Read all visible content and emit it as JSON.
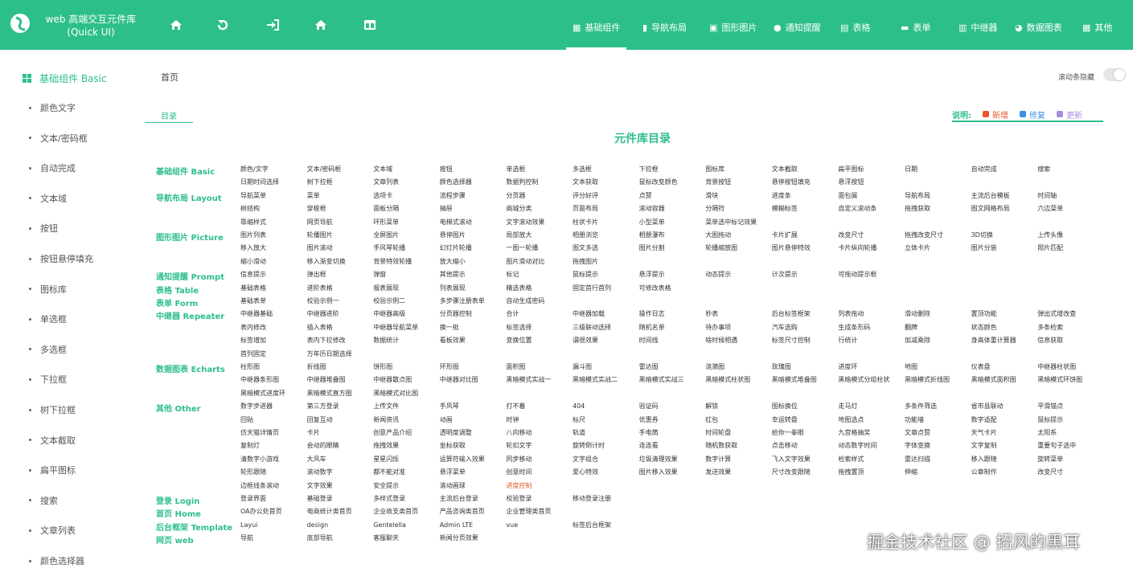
{
  "header": {
    "brand_line1": "web 高端交互元件库",
    "brand_line2": "(Quick UI)",
    "nav_icons": [
      "home-icon",
      "undo-icon",
      "login-icon",
      "home-icon",
      "layout-icon"
    ],
    "menu": [
      {
        "label": "基础组件",
        "icon": "grid-icon",
        "active": true
      },
      {
        "label": "导航布局",
        "icon": "book-icon"
      },
      {
        "label": "图形图片",
        "icon": "image-icon"
      },
      {
        "label": "通知提醒",
        "icon": "bell-icon"
      },
      {
        "label": "表格",
        "icon": "table-icon"
      },
      {
        "label": "表单",
        "icon": "form-icon"
      },
      {
        "label": "中继器",
        "icon": "repeater-icon"
      },
      {
        "label": "数据图表",
        "icon": "chart-icon"
      },
      {
        "label": "其他",
        "icon": "grid-icon"
      }
    ]
  },
  "sidebar": {
    "header": "基础组件 Basic",
    "items": [
      "颜色文字",
      "文本/密码框",
      "自动完成",
      "文本域",
      "按钮",
      "按钮悬停填充",
      "图标库",
      "单选框",
      "多选框",
      "下拉框",
      "树下拉框",
      "文本截取",
      "扁平图标",
      "搜索",
      "文章列表",
      "颜色选择器"
    ]
  },
  "breadcrumb": "首页",
  "scroll_toggle_label": "滚动条隐藏",
  "catalog_tab": "目录",
  "legend": {
    "title": "说明:",
    "items": [
      {
        "label": "新增",
        "color": "#e9572b"
      },
      {
        "label": "修复",
        "color": "#3d8fe3"
      },
      {
        "label": "更新",
        "color": "#a98ce0"
      }
    ]
  },
  "page_title": "元件库目录",
  "catalog": [
    {
      "title": "基础组件 Basic",
      "rows": [
        [
          "颜色/文字",
          "文本/密码框",
          "文本域",
          "按钮",
          "单选框",
          "多选框",
          "下拉框",
          "图标库",
          "文本截取",
          "扁平图标",
          "日期",
          "自动完成",
          "搜索"
        ],
        [
          "日期时间选择",
          "树下拉框",
          "文章列表",
          "颜色选择器",
          "数据判控制",
          "文本获取",
          "鼠标改变颜色",
          "背景按钮",
          "悬停按钮填充",
          "悬浮按钮"
        ]
      ]
    },
    {
      "title": "导航布局 Layout",
      "rows": [
        [
          "导航菜单",
          "菜单",
          "选项卡",
          "流程步骤",
          "分页器",
          "评分好评",
          "点赞",
          "滑块",
          "进度条",
          "面包屑",
          "导航布局",
          "主流后台模板",
          "时间轴"
        ],
        [
          "树结构",
          "穿梭框",
          "面板分隔",
          "抽屉",
          "商城分类",
          "页面布局",
          "滚动容器",
          "分隔符",
          "模糊标签",
          "自定义滚动条",
          "拖拽获取",
          "图文网格布局",
          "六边菜单"
        ],
        [
          "靠缩样式",
          "网页导航",
          "环形菜单",
          "电梯式滚动",
          "文字滚动效果",
          "柱状卡片",
          "小型菜单",
          "菜单选中标记效果"
        ]
      ]
    },
    {
      "title": "图形图片 Picture",
      "rows": [
        [
          "图片列表",
          "轮播图片",
          "全屏图片",
          "悬停图片",
          "局部放大",
          "相册浏览",
          "相册瀑布",
          "大图拖动",
          "卡片扩展",
          "改变尺寸",
          "拖拽改变尺寸",
          "3D切换",
          "上传头像"
        ],
        [
          "移入放大",
          "图片滚动",
          "手风琴轮播",
          "幻灯片轮播",
          "一图一轮播",
          "图文多选",
          "图片分割",
          "轮播缩放图",
          "图片悬停特效",
          "卡片纵向轮播",
          "立体卡片",
          "图片分装",
          "照片匹配"
        ],
        [
          "缩小滑动",
          "移入渐变切换",
          "背景特效轮播",
          "放大缩小",
          "图片滑动对比",
          "拖拽图片"
        ]
      ]
    },
    {
      "title": "通知提醒 Prompt",
      "rows": [
        [
          "信息提示",
          "弹出框",
          "弹窗",
          "其他提示",
          "标记",
          "鼠标提示",
          "悬浮提示",
          "动态提示",
          "计次提示",
          "可拖动提示框"
        ]
      ]
    },
    {
      "title": "表格 Table",
      "rows": [
        [
          "基础表格",
          "进阶表格",
          "报表展现",
          "列表展现",
          "精选表格",
          "固定首行首列",
          "可修改表格"
        ]
      ]
    },
    {
      "title": "表单 Form",
      "rows": [
        [
          "基础表单",
          "校验示例一",
          "校验示例二",
          "多步骤注册表单",
          "自动生成密码"
        ]
      ]
    },
    {
      "title": "中继器 Repeater",
      "rows": [
        [
          "中继器基础",
          "中继器进阶",
          "中继器高级",
          "分页器控制",
          "合计",
          "中继器加载",
          "操作日志",
          "秒表",
          "后台标签框架",
          "列表拖动",
          "滑动删除",
          "置顶功能",
          "弹出式增改查"
        ],
        [
          "表内修改",
          "插入表格",
          "中继器导航菜单",
          "换一批",
          "标签选择",
          "三级联动选择",
          "随机名单",
          "待办事项",
          "汽车选购",
          "生成条形码",
          "翻牌",
          "状态颜色",
          "多条检索"
        ],
        [
          "标签增加",
          "表内下拉修改",
          "数据统计",
          "看板效果",
          "变换位置",
          "谓很效果",
          "时间线",
          "啥时候相遇",
          "标签尺寸控制",
          "行统计",
          "加减乘除",
          "身高体重计算器",
          "信息获取"
        ],
        [
          "首列固定",
          "万年历日期选择"
        ]
      ]
    },
    {
      "title": "数据图表 Echarts",
      "rows": [
        [
          "柱形图",
          "折线图",
          "饼形图",
          "环形图",
          "面积图",
          "漏斗图",
          "雷达图",
          "涟漪图",
          "玫瑰图",
          "进度环",
          "地图",
          "仪表盘",
          "中继器柱状图"
        ],
        [
          "中继器条形图",
          "中继器堆叠图",
          "中继器散点图",
          "中继器对比图",
          "黑暗模式实战一",
          "黑暗模式实战二",
          "黑暗模式实战三",
          "黑暗模式柱状图",
          "黑暗模式堆叠图",
          "黑暗模式分组柱状",
          "黑暗模式折线图",
          "黑暗模式面积图",
          "黑暗模式环饼图"
        ],
        [
          "黑暗模式进度环",
          "黑暗模式直方图",
          "黑暗模式对比图"
        ]
      ]
    },
    {
      "title": "其他 Other",
      "rows": [
        [
          "数字步进器",
          "第三方登录",
          "上传文件",
          "手风琴",
          "打不着",
          "404",
          "验证码",
          "解锁",
          "图标换位",
          "走马灯",
          "多条件筛选",
          "省市县联动",
          "平滑锚点"
        ],
        [
          "回贴",
          "回复互动",
          "新闻资讯",
          "动画",
          "时钟",
          "标尺",
          "优惠券",
          "红包",
          "幸运转盘",
          "地图选点",
          "功能墙",
          "数字适配",
          "鼠标提示"
        ],
        [
          "仿天猫详情页",
          "卡片",
          "创意产品介绍",
          "透明度调整",
          "八向移动",
          "轨道",
          "手电筒",
          "时间轮盘",
          "给你一拳眼",
          "九宫格抽奖",
          "文章点赞",
          "天气卡片",
          "太阳系"
        ],
        [
          "复制灯",
          "会动的眼睛",
          "拖拽效果",
          "坐标获取",
          "轮扣文字",
          "旋转倒计时",
          "连连看",
          "随机数获取",
          "点击移动",
          "动态数字时间",
          "字体变换",
          "文字复制",
          "重要句子选中"
        ],
        [
          "清数字小游戏",
          "大风车",
          "星星闪烁",
          "运算符输入效果",
          "同步移动",
          "文字组合",
          "垃圾清理效果",
          "数字计算",
          "飞入文字效果",
          "检索样式",
          "雷达扫描",
          "移入跟随",
          "旋转菜单"
        ],
        [
          "轮形跟随",
          "滚动数字",
          "都不能对准",
          "悬浮菜单",
          "创意时间",
          "爱心特效",
          "图片移入效果",
          "发送效果",
          "尺寸改变跟随",
          "拖拽置顶",
          "伸缩",
          "公章制作",
          "改变尺寸"
        ],
        [
          "边框线条滚动",
          "文字效果",
          "安全提示",
          "滚动画球",
          "进度控制"
        ]
      ]
    },
    {
      "title": "登录 Login",
      "rows": [
        [
          "登录界面",
          "基础登录",
          "多样式登录",
          "主流后台登录",
          "校验登录",
          "移动登录注册"
        ]
      ]
    },
    {
      "title": "首页 Home",
      "rows": [
        [
          "OA办公处首页",
          "电商统计类首页",
          "企业收支类首页",
          "产品咨询类首页",
          "企业管理类首页"
        ]
      ]
    },
    {
      "title": "后台框架 Template",
      "rows": [
        [
          "Layui",
          "design",
          "Gentelella",
          "Admin LTE",
          "vue",
          "标签后台框架"
        ]
      ]
    },
    {
      "title": "网页 web",
      "rows": [
        [
          "导航",
          "底部导航",
          "客服聊天",
          "新闻分页效果"
        ]
      ]
    }
  ],
  "highlighted_items": [
    "进度控制"
  ],
  "watermark": "掘金技术社区 @ 招风的黑耳",
  "colors": {
    "accent": "#2dbf8a",
    "new": "#e9572b",
    "fixed": "#3d8fe3",
    "updated": "#a98ce0"
  }
}
